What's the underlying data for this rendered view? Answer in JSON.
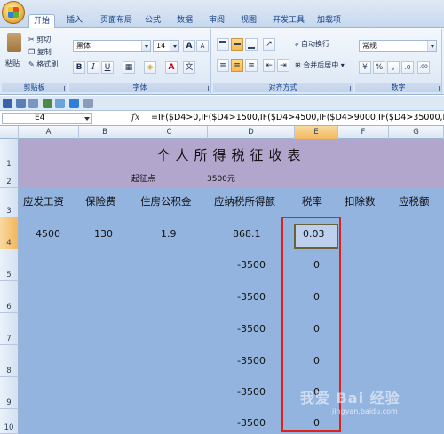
{
  "ribbon": {
    "tabs": [
      "开始",
      "插入",
      "页面布局",
      "公式",
      "数据",
      "审阅",
      "视图",
      "开发工具",
      "加载项"
    ],
    "clipboard": {
      "paste": "粘贴",
      "cut": "剪切",
      "copy": "复制",
      "format_painter": "格式刷",
      "label": "剪贴板"
    },
    "font": {
      "name": "黑体",
      "size": "14",
      "grow": "A",
      "shrink": "A",
      "bold": "B",
      "italic": "I",
      "underline": "U",
      "font_color": "A",
      "label": "字体"
    },
    "alignment": {
      "wrap": "自动换行",
      "merge": "合并后居中",
      "label": "对齐方式"
    },
    "number": {
      "format": "常规",
      "percent": "%",
      "comma": ",",
      "inc_decimal": ".0",
      "dec_decimal": ".00",
      "label": "数字"
    }
  },
  "formula_bar": {
    "name_box": "E4",
    "fx": "fx",
    "formula": "=IF($D4>0,IF($D4>1500,IF($D4>4500,IF($D4>9000,IF($D4>35000,IF"
  },
  "columns": [
    "A",
    "B",
    "C",
    "D",
    "E",
    "F",
    "G"
  ],
  "rows": [
    "1",
    "2",
    "3",
    "4",
    "5",
    "6",
    "7",
    "8",
    "9",
    "10"
  ],
  "sheet": {
    "title": "个人所得税征收表",
    "threshold_label": "起征点",
    "threshold_value": "3500元",
    "headers": [
      "应发工资",
      "保险费",
      "住房公积金",
      "应纳税所得额",
      "税率",
      "扣除数",
      "应税额"
    ],
    "row4": {
      "salary": "4500",
      "insurance": "130",
      "housing_fund": "1.9",
      "taxable": "868.1",
      "rate": "0.03"
    },
    "taxable_values": [
      "-3500",
      "-3500",
      "-3500",
      "-3500",
      "-3500",
      "-3500"
    ],
    "rate_values": [
      "0",
      "0",
      "0",
      "0",
      "0",
      "0"
    ]
  },
  "watermark": {
    "text": "我爱 Bai 经验",
    "url": "jingyan.baidu.com"
  },
  "colors": {
    "sheet_bg": "#94b4e0",
    "title_band": "#b3a6cd",
    "highlight": "#e0201a",
    "active_border": "#6c6138"
  }
}
